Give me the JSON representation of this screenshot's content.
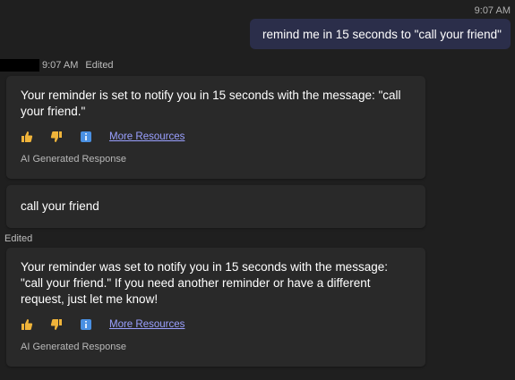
{
  "user_message": {
    "timestamp": "9:07 AM",
    "text": "remind me in 15 seconds to \"call your friend\""
  },
  "bot_header": {
    "timestamp": "9:07 AM",
    "status": "Edited"
  },
  "messages": [
    {
      "text": "Your reminder is set to notify you in 15 seconds with the message: \"call your friend.\"",
      "link_label": "More Resources",
      "disclaimer": "AI Generated Response"
    },
    {
      "text": "call your friend"
    },
    {
      "edited_label": "Edited",
      "text": "Your reminder was set to notify you in 15 seconds with the message: \"call your friend.\" If you need another reminder or have a different request, just let me know!",
      "link_label": "More Resources",
      "disclaimer": "AI Generated Response"
    }
  ],
  "icons": [
    "thumbs-up-icon",
    "thumbs-down-icon",
    "info-icon"
  ],
  "colors": {
    "background": "#1f1f1f",
    "user_bubble": "#2b2e4a",
    "bot_bubble": "#292929",
    "link": "#9aa0ff",
    "thumb": "#f0b43a",
    "info": "#4a90e2"
  }
}
